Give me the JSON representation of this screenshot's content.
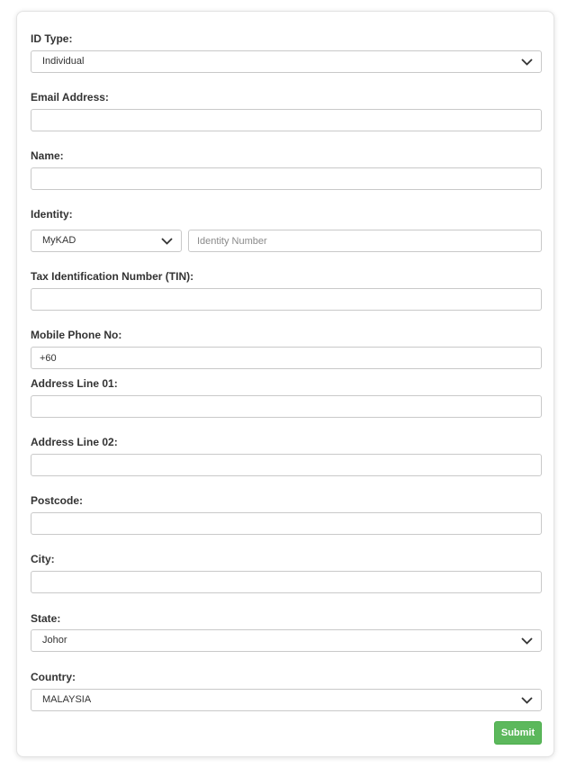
{
  "form": {
    "id_type": {
      "label": "ID Type:",
      "value": "Individual"
    },
    "email": {
      "label": "Email Address:",
      "value": ""
    },
    "name": {
      "label": "Name:",
      "value": ""
    },
    "identity": {
      "label": "Identity:",
      "type_value": "MyKAD",
      "number_placeholder": "Identity Number",
      "number_value": ""
    },
    "tin": {
      "label": "Tax Identification Number (TIN):",
      "value": ""
    },
    "mobile": {
      "label": "Mobile Phone No:",
      "value": "+60"
    },
    "address1": {
      "label": "Address Line 01:",
      "value": ""
    },
    "address2": {
      "label": "Address Line 02:",
      "value": ""
    },
    "postcode": {
      "label": "Postcode:",
      "value": ""
    },
    "city": {
      "label": "City:",
      "value": ""
    },
    "state": {
      "label": "State:",
      "value": "Johor"
    },
    "country": {
      "label": "Country:",
      "value": "MALAYSIA"
    },
    "submit_label": "Submit"
  },
  "icons": {
    "dropdown": "chevron-down-icon"
  },
  "colors": {
    "submit_bg": "#5cb85c",
    "border": "#c9c9c9",
    "label": "#333333"
  }
}
